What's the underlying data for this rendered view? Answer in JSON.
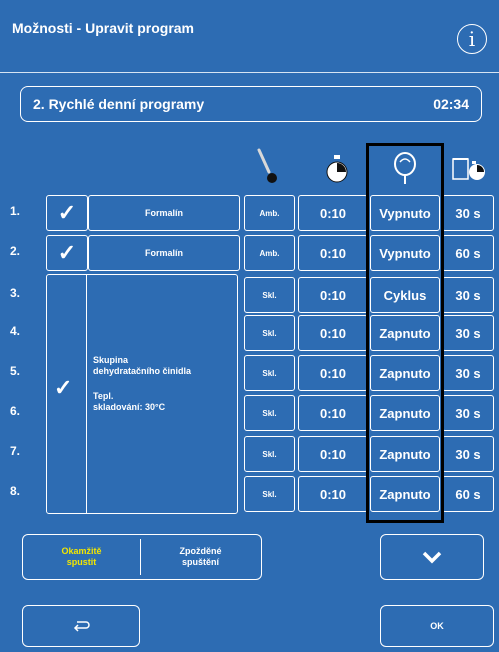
{
  "header": {
    "title": "Možnosti - Upravit program",
    "info_glyph": "i",
    "info_icon": "info-icon"
  },
  "program": {
    "name": "2. Rychlé denní programy",
    "time": "02:34"
  },
  "column_icons": [
    "thermometer-icon",
    "timer-icon",
    "agitation-icon",
    "drip-time-icon"
  ],
  "rows": [
    {
      "num": "1.",
      "reagent": "Formalín",
      "temp": "Amb.",
      "time": "0:10",
      "agitation": "Vypnuto",
      "drip": "30 s"
    },
    {
      "num": "2.",
      "reagent": "Formalín",
      "temp": "Amb.",
      "time": "0:10",
      "agitation": "Vypnuto",
      "drip": "60 s"
    },
    {
      "num": "3.",
      "temp": "Skl.",
      "time": "0:10",
      "agitation": "Cyklus",
      "drip": "30 s"
    },
    {
      "num": "4.",
      "temp": "Skl.",
      "time": "0:10",
      "agitation": "Zapnuto",
      "drip": "30 s"
    },
    {
      "num": "5.",
      "temp": "Skl.",
      "time": "0:10",
      "agitation": "Zapnuto",
      "drip": "30 s"
    },
    {
      "num": "6.",
      "temp": "Skl.",
      "time": "0:10",
      "agitation": "Zapnuto",
      "drip": "30 s"
    },
    {
      "num": "7.",
      "temp": "Skl.",
      "time": "0:10",
      "agitation": "Zapnuto",
      "drip": "30 s"
    },
    {
      "num": "8.",
      "temp": "Skl.",
      "time": "0:10",
      "agitation": "Zapnuto",
      "drip": "60 s"
    }
  ],
  "group": {
    "name_line1": "Skupina",
    "name_line2": "dehydratačního činidla",
    "temp_line1": "Tepl.",
    "temp_line2": "skladování: 30°C"
  },
  "buttons": {
    "start_now_line1": "Okamžitě",
    "start_now_line2": "spustit",
    "delayed_line1": "Zpožděné",
    "delayed_line2": "spuštění",
    "ok": "OK"
  },
  "colors": {
    "background": "#2d6cb3",
    "active_text": "#f2e600",
    "highlight_border": "#000000"
  }
}
